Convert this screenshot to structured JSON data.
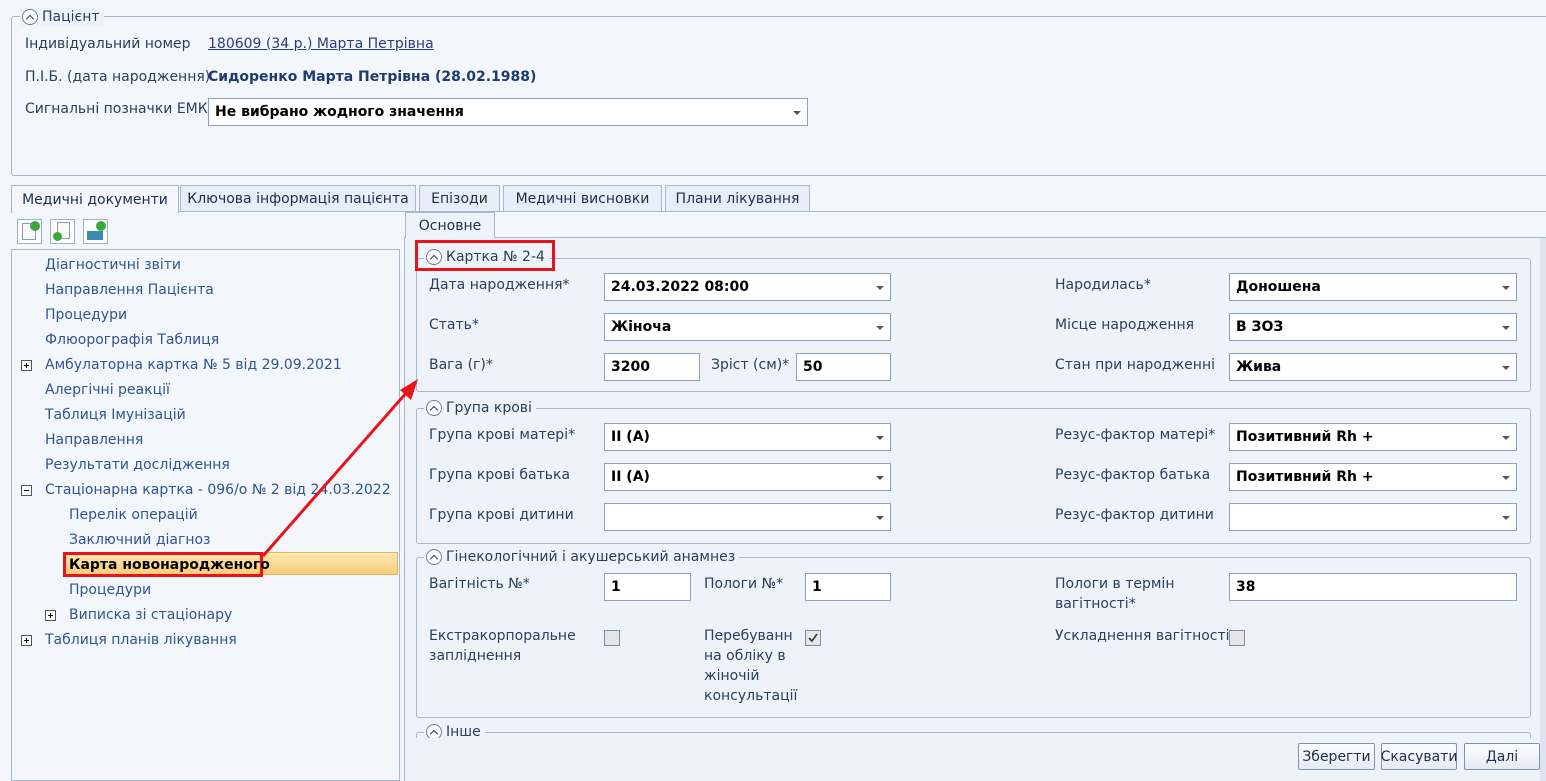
{
  "patient": {
    "legend": "Пацієнт",
    "id_label": "Індивідуальний номер",
    "id_value": "180609 (34 р.) Марта Петрівна",
    "name_label": "П.І.Б. (дата народження)",
    "name_value": "Сидоренко Марта Петрівна (28.02.1988)",
    "signals_label": "Сигнальні позначки ЕМК",
    "signals_value": "Не вибрано жодного значення"
  },
  "main_tabs": [
    "Медичні документи",
    "Ключова інформація пацієнта",
    "Епізоди",
    "Медичні висновки",
    "Плани лікування"
  ],
  "tree": {
    "items": [
      "Діагностичні звіти",
      "Направлення Пацієнта",
      "Процедури",
      "Флюорографія Таблиця",
      "Амбулаторна картка № 5 від 29.09.2021",
      "Алергічні реакції",
      "Таблиця Імунізацій",
      "Направлення",
      "Результати дослідження",
      "Стаціонарна картка - 096/о № 2 від 24.03.2022",
      "Таблиця планів лікування"
    ],
    "children": [
      "Перелік операцій",
      "Заключний діагноз",
      "Карта новонародженого",
      "Процедури",
      "Виписка зі стаціонару"
    ],
    "selected": "Карта новонародженого"
  },
  "sub_tab": "Основне",
  "card": {
    "legend": "Картка № 2-4",
    "birth_date_label": "Дата народження*",
    "birth_date": "24.03.2022 08:00",
    "born_label": "Народилась*",
    "born": "Доношена",
    "sex_label": "Стать*",
    "sex": "Жіноча",
    "place_label": "Місце народження",
    "place": "В ЗОЗ",
    "weight_label": "Вага (г)*",
    "weight": "3200",
    "height_label": "Зріст (см)*",
    "height": "50",
    "state_label": "Стан при народженні",
    "state": "Жива"
  },
  "blood": {
    "legend": "Група крові",
    "mother_label": "Група крові матері*",
    "mother": "II (A)",
    "rh_mother_label": "Резус-фактор матері*",
    "rh_mother": "Позитивний Rh +",
    "father_label": "Група крові батька",
    "father": "II (A)",
    "rh_father_label": "Резус-фактор батька",
    "rh_father": "Позитивний Rh +",
    "child_label": "Група крові дитини",
    "child": "",
    "rh_child_label": "Резус-фактор дитини",
    "rh_child": ""
  },
  "anamnesis": {
    "legend": "Гінекологічний і акушерський анамнез",
    "pregnancy_label": "Вагітність №*",
    "pregnancy": "1",
    "births_label": "Пологи №*",
    "births": "1",
    "term_label_1": "Пологи в термін",
    "term_label_2": "вагітності*",
    "term": "38",
    "eco_label_1": "Екстракорпоральне",
    "eco_label_2": "запліднення",
    "eco_checked": false,
    "reg_label_1": "Перебування",
    "reg_label_2": "на обліку в",
    "reg_label_3": "жіночій",
    "reg_label_4": "консультації",
    "reg_checked": true,
    "compl_label": "Ускладнення вагітності",
    "compl_checked": false
  },
  "other": {
    "legend": "Інше"
  },
  "buttons": {
    "save": "Зберегти",
    "cancel": "Скасувати",
    "next": "Далі"
  },
  "colors": {
    "annotation": "#e8141a",
    "selected_bg": "#fcd98d",
    "link": "#2f5594"
  }
}
